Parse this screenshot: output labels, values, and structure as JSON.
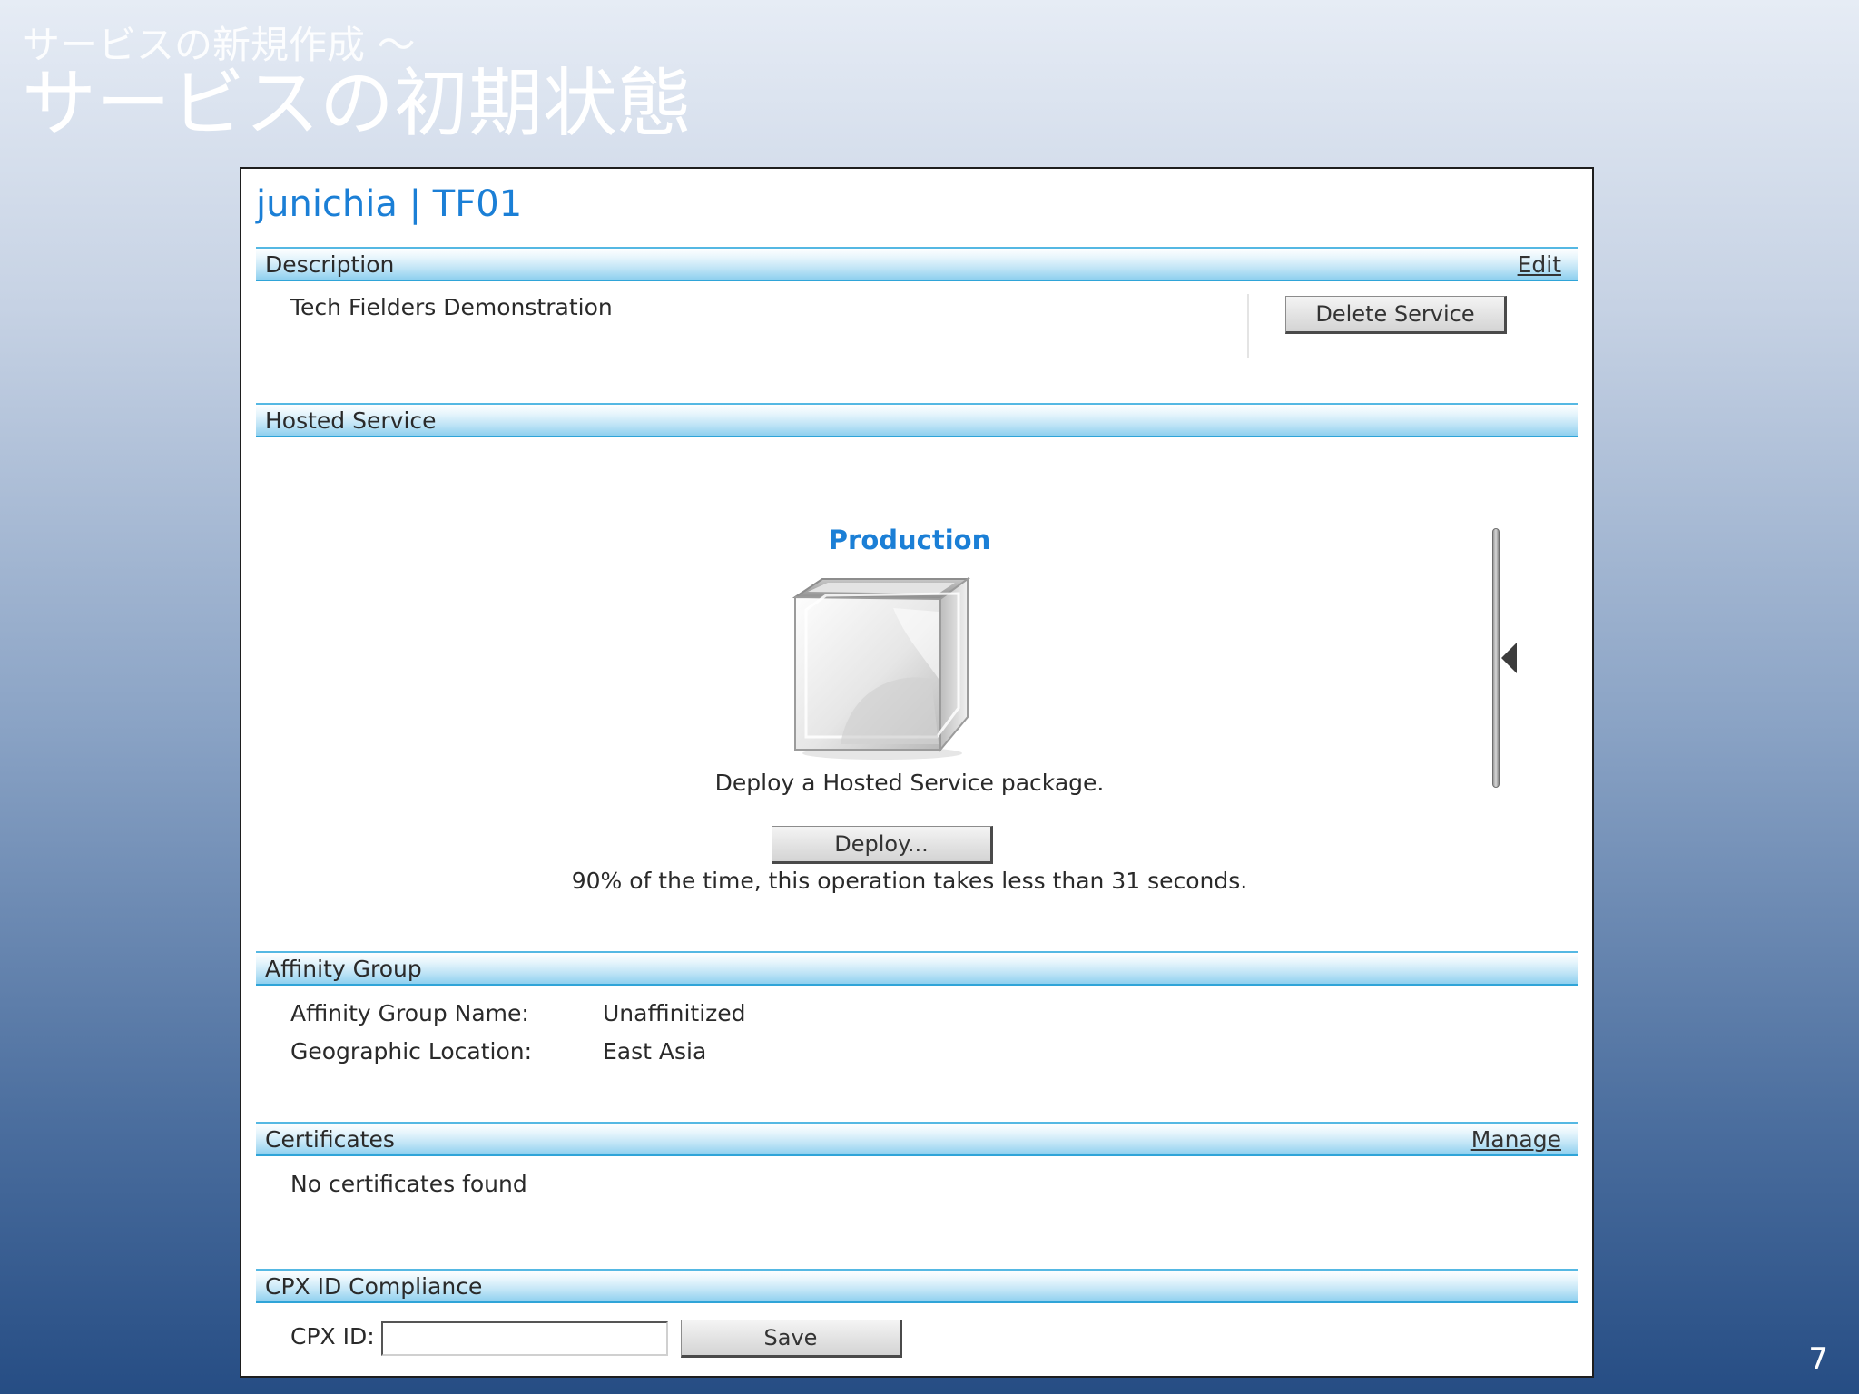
{
  "slide": {
    "subtitle": "サービスの新規作成 ～",
    "title": "サービスの初期状態",
    "page_number": "7"
  },
  "panel": {
    "title": "junichia | TF01"
  },
  "description": {
    "label": "Description",
    "edit_link": "Edit",
    "text": "Tech Fielders Demonstration",
    "delete_button": "Delete Service"
  },
  "hosted_service": {
    "label": "Hosted Service",
    "environment": "Production",
    "deploy_prompt": "Deploy a Hosted Service package.",
    "deploy_button": "Deploy...",
    "timing_note": "90% of the time, this operation takes less than 31 seconds.",
    "package_icon": "cube-icon",
    "nav_icon": "left-arrow-icon"
  },
  "affinity_group": {
    "label": "Affinity Group",
    "rows": [
      {
        "key": "Affinity Group Name:",
        "value": "Unaffinitized"
      },
      {
        "key": "Geographic Location:",
        "value": "East Asia"
      }
    ]
  },
  "certificates": {
    "label": "Certificates",
    "manage_link": "Manage",
    "empty_text": "No certificates found"
  },
  "cpx": {
    "label": "CPX ID Compliance",
    "field_label": "CPX ID:",
    "value": "",
    "save_button": "Save"
  },
  "colors": {
    "title_blue": "#1b7fd6",
    "bar_border": "#2fa4d8"
  }
}
